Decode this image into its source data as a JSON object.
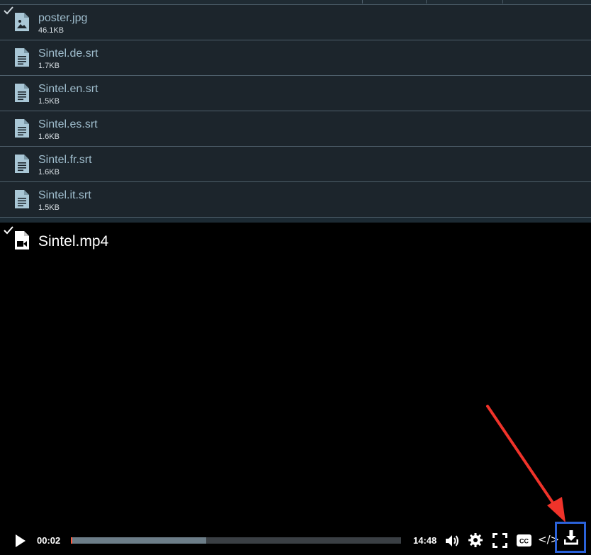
{
  "files": [
    {
      "name": "poster.jpg",
      "size": "46.1KB",
      "type": "image",
      "checked": true
    },
    {
      "name": "Sintel.de.srt",
      "size": "1.7KB",
      "type": "text",
      "checked": false
    },
    {
      "name": "Sintel.en.srt",
      "size": "1.5KB",
      "type": "text",
      "checked": false
    },
    {
      "name": "Sintel.es.srt",
      "size": "1.6KB",
      "type": "text",
      "checked": false
    },
    {
      "name": "Sintel.fr.srt",
      "size": "1.6KB",
      "type": "text",
      "checked": false
    },
    {
      "name": "Sintel.it.srt",
      "size": "1.5KB",
      "type": "text",
      "checked": false
    }
  ],
  "video": {
    "title": "Sintel.mp4",
    "checked": true,
    "current_time": "00:02",
    "duration": "14:48",
    "buffered_fraction": 0.41,
    "played_fraction": 0.002,
    "embed_label": "</>"
  },
  "colors": {
    "file_name": "#9fbdcd",
    "highlight_box": "#2b62d9",
    "annotation_arrow": "#f0332a"
  },
  "icons": {
    "play": "play-icon",
    "volume": "volume-icon",
    "settings": "gear-icon",
    "fullscreen": "fullscreen-icon",
    "captions": "cc-icon",
    "embed": "embed-icon",
    "download": "download-icon"
  }
}
